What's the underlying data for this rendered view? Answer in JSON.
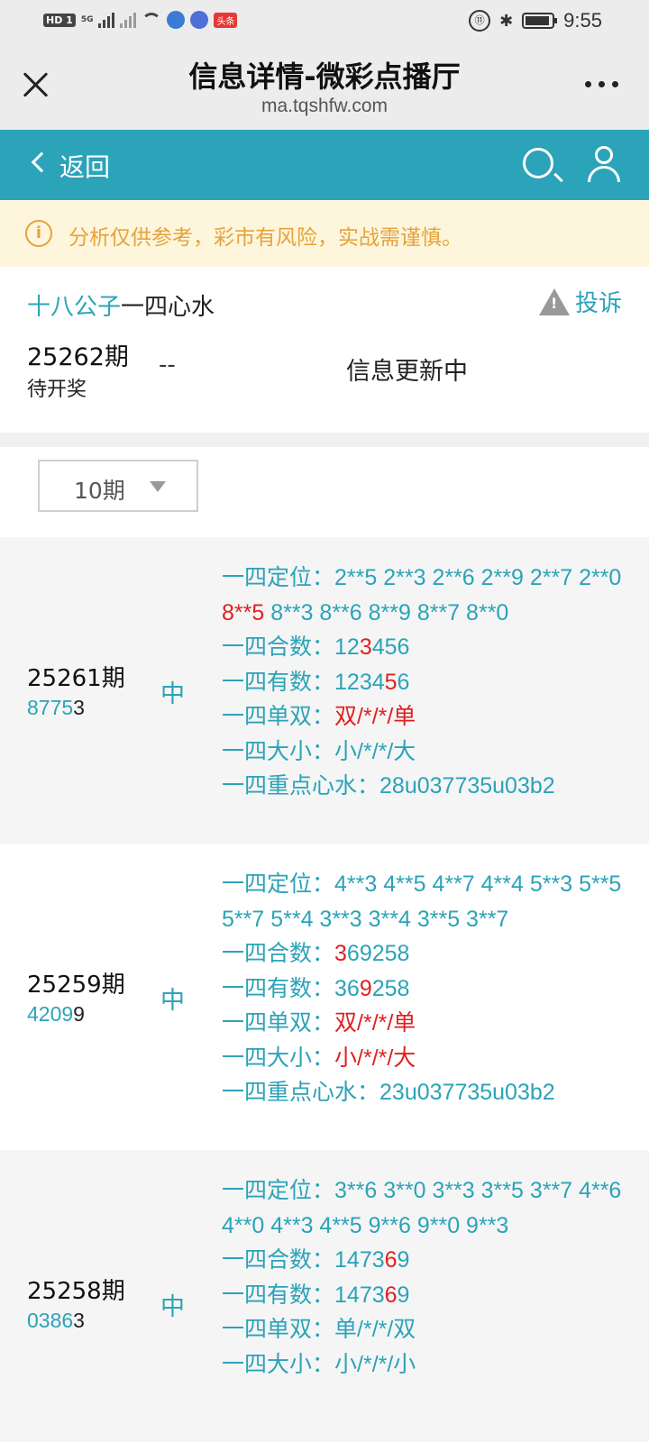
{
  "status_bar": {
    "network": "HD 1",
    "gen": "5G",
    "app_badge": "头条",
    "time": "9:55"
  },
  "title_bar": {
    "title": "信息详情-微彩点播厅",
    "url": "ma.tqshfw.com"
  },
  "nav": {
    "back_label": "返回"
  },
  "notice": {
    "text": "分析仅供参考，彩市有风险，实战需谨慎。"
  },
  "header": {
    "author_prefix": "十八公子",
    "author_suffix": "一四心水",
    "complain_label": "投诉",
    "current_issue": "25262期",
    "current_status": "待开奖",
    "current_result": "--",
    "current_info": "信息更新中"
  },
  "filter": {
    "selected": "10期"
  },
  "records": [
    {
      "issue": "25261期",
      "num_teal": "8775",
      "num_black": "3",
      "result": "中",
      "lines": [
        {
          "label": "一四定位：",
          "parts": [
            [
              "2**5 2**3 2**6 2**9 2**7 2**0 ",
              0
            ],
            [
              "8**5",
              1
            ],
            [
              " 8**3 8**6 8**9 8**7 8**0",
              0
            ]
          ]
        },
        {
          "label": "一四合数：",
          "parts": [
            [
              "12",
              0
            ],
            [
              "3",
              1
            ],
            [
              "456",
              0
            ]
          ]
        },
        {
          "label": "一四有数：",
          "parts": [
            [
              "1234",
              0
            ],
            [
              "5",
              1
            ],
            [
              "6",
              0
            ]
          ]
        },
        {
          "label": "一四单双：",
          "parts": [
            [
              "双/*/*/单",
              1
            ]
          ]
        },
        {
          "label": "一四大小：",
          "parts": [
            [
              "小/*/*/大",
              0
            ]
          ]
        },
        {
          "label": "一四重点心水：",
          "parts": [
            [
              "28u037735u03b2",
              0
            ]
          ]
        }
      ]
    },
    {
      "issue": "25259期",
      "num_teal": "4209",
      "num_black": "9",
      "result": "中",
      "lines": [
        {
          "label": "一四定位：",
          "parts": [
            [
              "4**3 4**5 4**7 4**4 5**3 5**5 5**7 5**4 3**3 3**4 3**5 3**7",
              0
            ]
          ]
        },
        {
          "label": "一四合数：",
          "parts": [
            [
              "3",
              1
            ],
            [
              "69258",
              0
            ]
          ]
        },
        {
          "label": "一四有数：",
          "parts": [
            [
              "36",
              0
            ],
            [
              "9",
              1
            ],
            [
              "258",
              0
            ]
          ]
        },
        {
          "label": "一四单双：",
          "parts": [
            [
              "双/*/*/单",
              1
            ]
          ]
        },
        {
          "label": "一四大小：",
          "parts": [
            [
              "小/*/*/大",
              1
            ]
          ]
        },
        {
          "label": "一四重点心水：",
          "parts": [
            [
              "23u037735u03b2",
              0
            ]
          ]
        }
      ]
    },
    {
      "issue": "25258期",
      "num_teal": "0386",
      "num_black": "3",
      "result": "中",
      "lines": [
        {
          "label": "一四定位：",
          "parts": [
            [
              "3**6 3**0 3**3 3**5 3**7 4**6 4**0 4**3 4**5 9**6 9**0 9**3",
              0
            ]
          ]
        },
        {
          "label": "一四合数：",
          "parts": [
            [
              "1473",
              0
            ],
            [
              "6",
              1
            ],
            [
              "9",
              0
            ]
          ]
        },
        {
          "label": "一四有数：",
          "parts": [
            [
              "1473",
              0
            ],
            [
              "6",
              1
            ],
            [
              "9",
              0
            ]
          ]
        },
        {
          "label": "一四单双：",
          "parts": [
            [
              "单/*/*/双",
              0
            ]
          ]
        },
        {
          "label": "一四大小：",
          "parts": [
            [
              "小/*/*/小",
              0
            ]
          ]
        }
      ]
    }
  ],
  "colors": {
    "accent": "#2ba3b8",
    "highlight": "#e02020",
    "notice": "#e6a23c"
  }
}
